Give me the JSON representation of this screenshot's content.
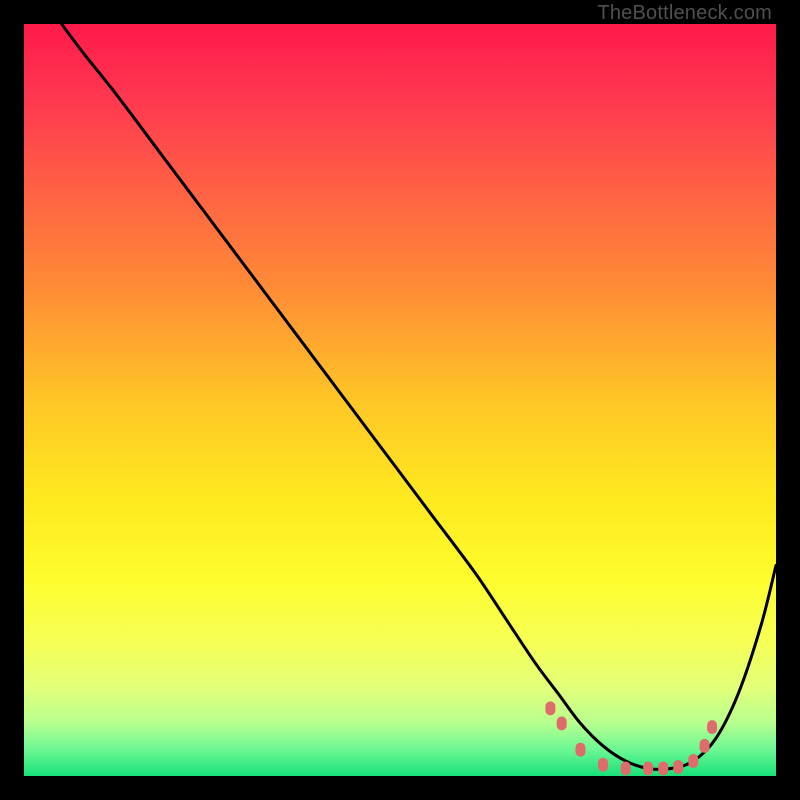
{
  "watermark": "TheBottleneck.com",
  "gradient": {
    "stops": [
      {
        "offset": 0.0,
        "color": "#ff1a4b"
      },
      {
        "offset": 0.1,
        "color": "#ff3850"
      },
      {
        "offset": 0.22,
        "color": "#ff6144"
      },
      {
        "offset": 0.35,
        "color": "#ff8b36"
      },
      {
        "offset": 0.5,
        "color": "#ffc627"
      },
      {
        "offset": 0.63,
        "color": "#ffe91f"
      },
      {
        "offset": 0.74,
        "color": "#fdfd2e"
      },
      {
        "offset": 0.82,
        "color": "#f6ff55"
      },
      {
        "offset": 0.88,
        "color": "#e4ff78"
      },
      {
        "offset": 0.93,
        "color": "#b7ff8f"
      },
      {
        "offset": 0.965,
        "color": "#6cf793"
      },
      {
        "offset": 1.0,
        "color": "#18e07a"
      }
    ]
  },
  "chart_data": {
    "type": "line",
    "title": "",
    "xlabel": "",
    "ylabel": "",
    "x_range": [
      0,
      100
    ],
    "y_range": [
      0,
      100
    ],
    "series": [
      {
        "name": "bottleneck-curve",
        "x": [
          5,
          8,
          12,
          18,
          24,
          30,
          36,
          42,
          48,
          54,
          60,
          64,
          68,
          71,
          74,
          77,
          80,
          83,
          86,
          89,
          92,
          95,
          98,
          100
        ],
        "y": [
          100,
          96,
          91,
          83,
          75,
          67,
          59,
          51,
          43,
          35,
          27,
          21,
          15,
          11,
          7,
          4,
          2,
          1,
          1,
          2,
          5,
          11,
          20,
          28
        ]
      }
    ],
    "markers": {
      "name": "optimal-range-dots",
      "color": "#e06b6b",
      "x": [
        70,
        71.5,
        74,
        77,
        80,
        83,
        85,
        87,
        89,
        90.5,
        91.5
      ],
      "y": [
        9,
        7,
        3.5,
        1.5,
        1,
        1,
        1,
        1.2,
        2,
        4,
        6.5
      ]
    }
  }
}
